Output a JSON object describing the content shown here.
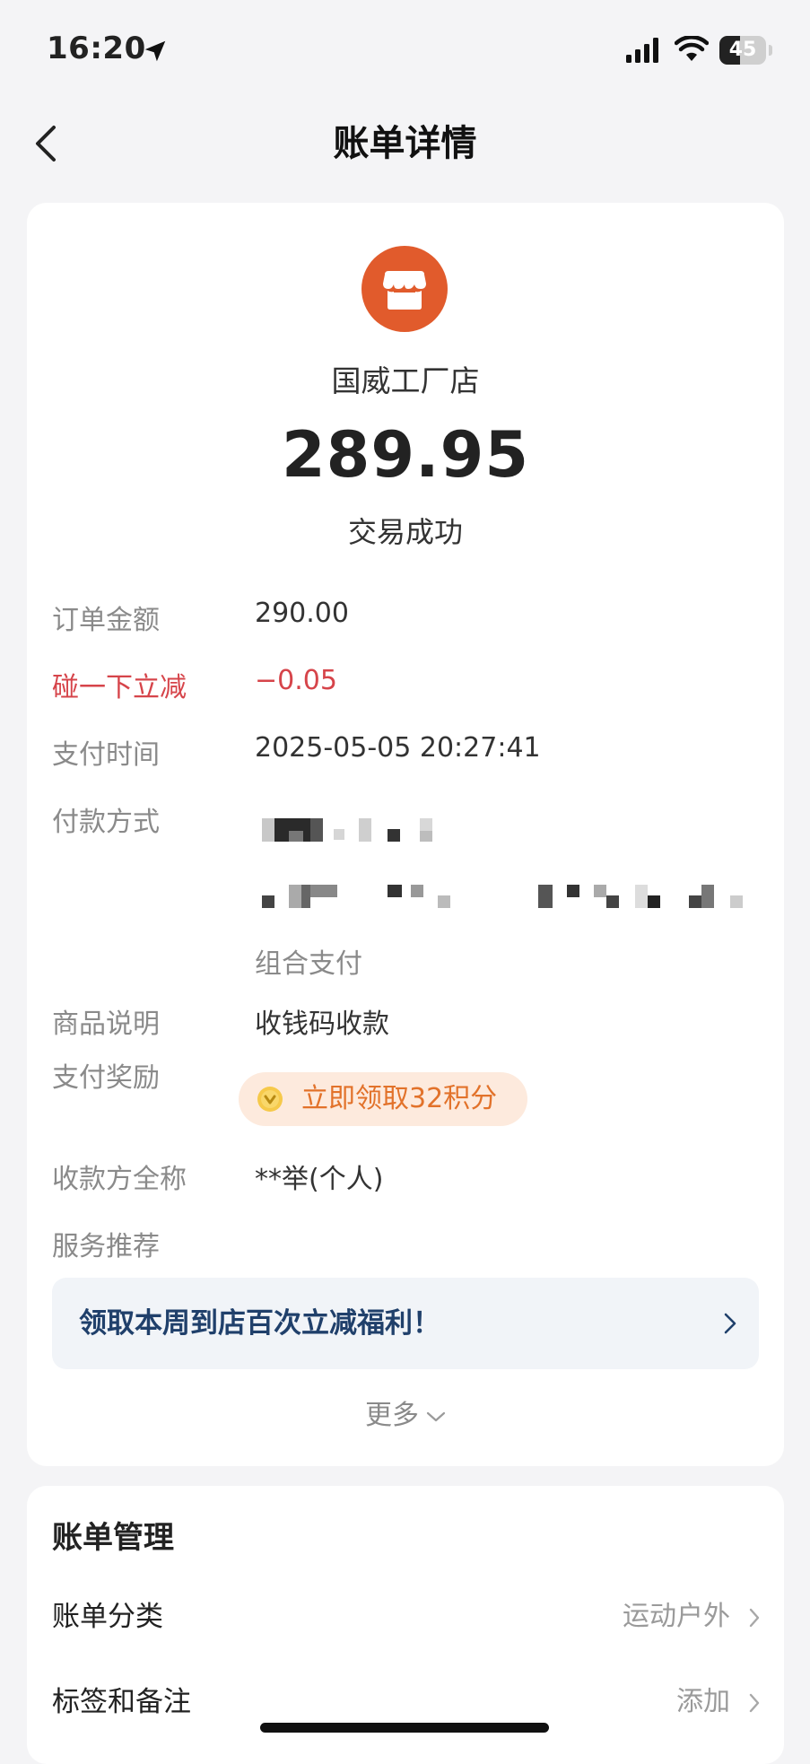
{
  "status_bar": {
    "time": "16:20",
    "battery": "45"
  },
  "nav": {
    "title": "账单详情"
  },
  "merchant": {
    "name": "国威工厂店",
    "amount": "289.95",
    "status": "交易成功"
  },
  "details": {
    "order_amount_label": "订单金额",
    "order_amount_value": "290.00",
    "discount_label": "碰一下立减",
    "discount_value": "−0.05",
    "pay_time_label": "支付时间",
    "pay_time_value": "2025-05-05 20:27:41",
    "pay_method_label": "付款方式",
    "pay_method_note": "组合支付",
    "goods_label": "商品说明",
    "goods_value": "收钱码收款",
    "reward_label": "支付奖励",
    "reward_value": "立即领取32积分",
    "payee_label": "收款方全称",
    "payee_value": "**举(个人)",
    "service_label": "服务推荐",
    "promo_text": "领取本周到店百次立减福利！",
    "more_label": "更多"
  },
  "management": {
    "title": "账单管理",
    "category_label": "账单分类",
    "category_value": "运动户外",
    "tags_label": "标签和备注",
    "tags_value": "添加"
  },
  "colors": {
    "accent_orange": "#e15b2c",
    "discount_red": "#d6444a",
    "reward_orange": "#e2722a",
    "promo_blue": "#20406b"
  }
}
